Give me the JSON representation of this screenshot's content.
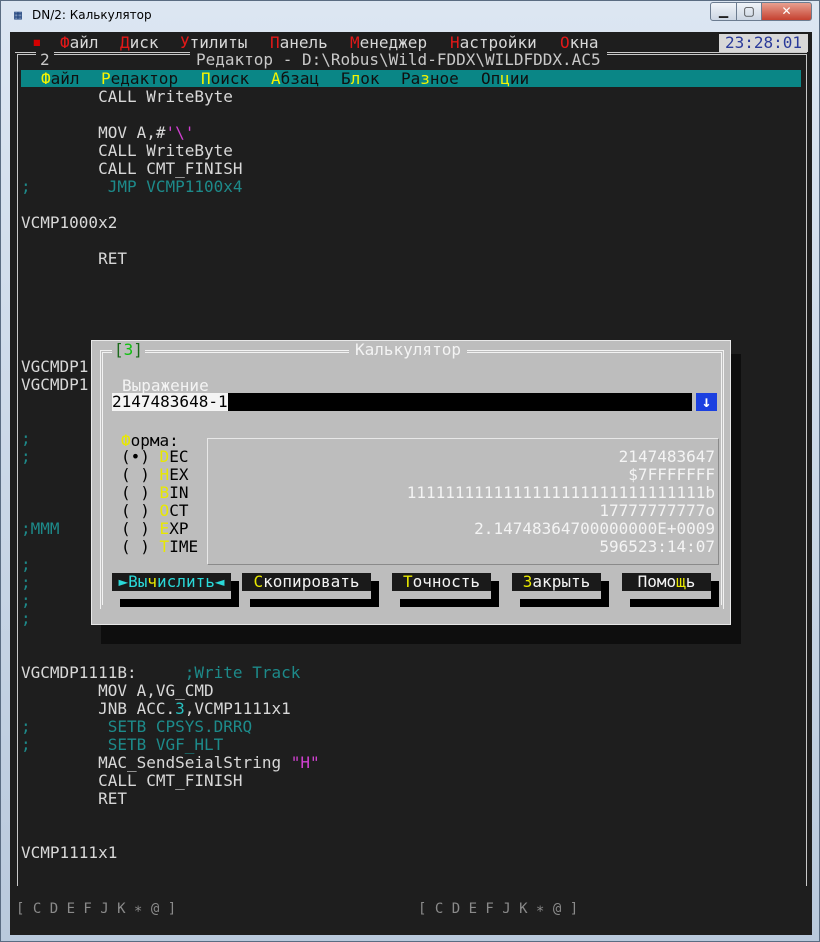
{
  "window": {
    "title": "DN/2: Калькулятор",
    "min_label": "▁",
    "max_label": "▢",
    "close_label": "✕",
    "icon": "calculator-app-icon"
  },
  "top_menu": {
    "marker": "▪",
    "items": [
      {
        "hot": "Ф",
        "rest": "айл"
      },
      {
        "hot": "Д",
        "rest": "иск"
      },
      {
        "hot": "У",
        "rest": "тилиты"
      },
      {
        "hot": "П",
        "rest": "анель"
      },
      {
        "hot": "М",
        "rest": "енеджер"
      },
      {
        "hot": "Н",
        "rest": "астройки"
      },
      {
        "hot": "О",
        "rest": "кна"
      }
    ],
    "clock": "23:28:01"
  },
  "editor": {
    "window_number": "2",
    "title": "Редактор - D:\\Robus\\Wild-FDDX\\WILDFDDX.AC5",
    "menu": [
      {
        "hot": "Ф",
        "rest": "айл"
      },
      {
        "pre": "",
        "hot": "Р",
        "rest": "едактор"
      },
      {
        "hot": "П",
        "rest": "оиск"
      },
      {
        "hot": "А",
        "rest": "бзац"
      },
      {
        "pre": "Б",
        "hot": "л",
        "rest": "ок"
      },
      {
        "pre": "Ра",
        "hot": "з",
        "rest": "ное"
      },
      {
        "pre": "Оп",
        "hot": "ц",
        "rest": "ии"
      }
    ],
    "lines": {
      "l1": "        CALL WriteByte",
      "l3a": "        MOV A,#",
      "l3b": "'\\'",
      "l4": "        CALL WriteByte",
      "l5": "        CALL CMT_FINISH",
      "l6": ";        JMP VCMP1100x4",
      "l8": "VCMP1000x2",
      "l10": "        RET",
      "l16": "VGCMDP1",
      "l17": "VGCMDP1",
      "l20": ";",
      "l21": ";",
      "l24": ";MMM",
      "l27": ";",
      "l28": ";",
      "l29": ";",
      "l30": ";",
      "l36a": "VGCMDP1111B:",
      "l36b": "     ;Write Track",
      "l37": "        MOV A,VG_CMD",
      "l38a": "        JNB ACC.",
      "l38b": "3",
      "l38c": ",VCMP1111x1",
      "l39": ";        SETB CPSYS.DRRQ",
      "l40": ";        SETB VGF_HLT",
      "l41a": "        MAC_SendSeialString ",
      "l41b": "\"H\"",
      "l42": "        CALL CMT_FINISH",
      "l43": "        RET",
      "l46": "VCMP1111x1"
    },
    "status_left": "[ C D E F J K ∗ @ ]",
    "status_right": "[ C D E F J K ∗ @ ]"
  },
  "calculator": {
    "window_number": "3",
    "title": "Калькулятор",
    "expression_label": "Выражение",
    "expression_value": "2147483648-1",
    "history_arrow": "↓",
    "form_label_hot": "Ф",
    "form_label_rest": "орма:",
    "formats": [
      {
        "radio": "(•)",
        "hot": "D",
        "rest": "EC",
        "result": "2147483647",
        "selected": true
      },
      {
        "radio": "( )",
        "hot": "H",
        "rest": "EX",
        "result": "$7FFFFFFF",
        "selected": false
      },
      {
        "radio": "( )",
        "hot": "B",
        "rest": "IN",
        "result": "1111111111111111111111111111111b",
        "selected": false
      },
      {
        "radio": "( )",
        "hot": "O",
        "rest": "CT",
        "result": "17777777777o",
        "selected": false
      },
      {
        "radio": "( )",
        "hot": "E",
        "rest": "XP",
        "result": "2.14748364700000000E+0009",
        "selected": false
      },
      {
        "radio": "( )",
        "hot": "T",
        "rest": "IME",
        "result": "596523:14:07",
        "selected": false
      }
    ],
    "buttons": {
      "calc": {
        "pre": "►Вы",
        "hot": "ч",
        "rest": "ислить◄"
      },
      "copy": {
        "pre": "",
        "hot": "С",
        "rest": "копировать"
      },
      "precision": {
        "pre": "",
        "hot": "Т",
        "rest": "очность"
      },
      "close": {
        "pre": "",
        "hot": "З",
        "rest": "акрыть"
      },
      "help": {
        "pre": "Помо",
        "hot": "щ",
        "rest": "ь"
      }
    }
  }
}
